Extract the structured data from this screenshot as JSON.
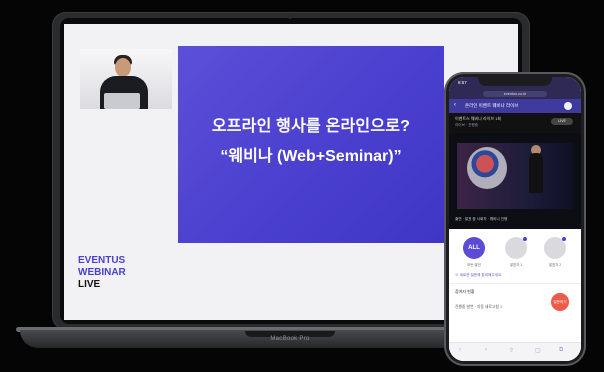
{
  "laptop": {
    "base_label": "MacBook Pro",
    "slide": {
      "line1": "오프라인 행사를 온라인으로?",
      "line2": "“웨비나 (Web+Seminar)”"
    },
    "brand": {
      "line1": "EVENTUS",
      "line2": "WEBINAR",
      "line3": "LIVE"
    }
  },
  "phone": {
    "status_time": "8:57",
    "url": "eventus.co.kr",
    "app_title": "온라인 이벤트 웨비나 라이브",
    "event_title": "이벤트스 웨비나 라이브 1회",
    "event_sub": "라이브 · 진행중",
    "live_badge": "LIVE",
    "video_caption": "출연 · 발표 중 사회자 · 웨비나 진행",
    "speakers": [
      {
        "label": "ALL",
        "caption": "모든 발언"
      },
      {
        "label": "",
        "caption": "발표자 1"
      },
      {
        "label": "",
        "caption": "발표자 2"
      }
    ],
    "notice": "※ 새로운 질문에 참여해주세요",
    "section_title": "참여자 현황",
    "list_item": "진행중 발언 · 자동 새로고침 1",
    "fab_label": "질문하기"
  },
  "colors": {
    "slide_purple": "#4a3fcf",
    "brand_purple": "#4b40cf",
    "app_header": "#3f3b9e",
    "fab_red": "#f05a4a"
  }
}
